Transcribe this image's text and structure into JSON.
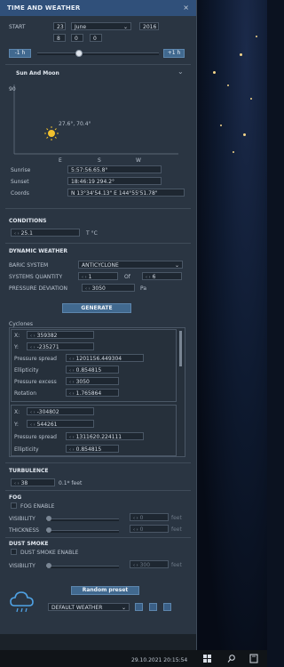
{
  "window": {
    "title": "TIME AND WEATHER",
    "close": "×"
  },
  "start": {
    "label": "START",
    "day": "23",
    "month": "June",
    "year": "2016",
    "hour": "8",
    "minute": "0",
    "second": "0",
    "minus_label": "-1 h",
    "plus_label": "+1 h",
    "slider_fraction": 0.34
  },
  "sun_moon": {
    "title": "Sun And Moon",
    "scale_top": "90",
    "sun_pos_label": "27.6°, 70.4°",
    "compass": [
      "E",
      "S",
      "W"
    ],
    "sunrise_label": "Sunrise",
    "sunrise": "5:57:56.65.8°",
    "sunset_label": "Sunset",
    "sunset": "18:46:19 294.2°",
    "coords_label": "Coords",
    "coords": "N 13°34'54.13\"  E 144°55'51.78\""
  },
  "conditions": {
    "title": "CONDITIONS",
    "temp": "25.1",
    "unit": "T °C"
  },
  "dynamic_weather": {
    "title": "DYNAMIC WEATHER",
    "baric_label": "BARIC SYSTEM",
    "baric_value": "ANTICYCLONE",
    "systems_label": "SYSTEMS QUANTITY",
    "systems_value": "1",
    "of_label": "Of",
    "systems_max": "6",
    "pressure_label": "PRESSURE DEVIATION",
    "pressure_value": "3050",
    "pressure_unit": "Pa",
    "generate_label": "GENERATE",
    "cyclones_label": "Cyclones",
    "cyclones": [
      {
        "x": "359382",
        "y": "-235271",
        "spread": "1201156.449304",
        "ellipticity": "0.854815",
        "excess": "3050",
        "rotation": "1.765864"
      },
      {
        "x": "-304802",
        "y": "544261",
        "spread": "1311620.224111",
        "ellipticity": "0.854815"
      }
    ],
    "field_labels": {
      "x": "X:",
      "y": "Y:",
      "spread": "Pressure spread",
      "ellipticity": "Ellipticity",
      "excess": "Pressure excess",
      "rotation": "Rotation"
    }
  },
  "turbulence": {
    "title": "TURBULENCE",
    "value": "38",
    "unit": "0.1* feet"
  },
  "fog": {
    "title": "FOG",
    "enable_label": "FOG ENABLE",
    "visibility_label": "VISIBILITY",
    "thickness_label": "THICKNESS",
    "visibility_value": "0",
    "thickness_value": "0",
    "unit": "feet"
  },
  "dust": {
    "title": "DUST SMOKE",
    "enable_label": "DUST SMOKE ENABLE",
    "visibility_label": "VISIBILITY",
    "visibility_value": "300",
    "unit": "feet"
  },
  "preset": {
    "random_label": "Random preset",
    "weather_value": "DEFAULT WEATHER"
  },
  "taskbar": {
    "datetime": "29.10.2021 20:15:54"
  }
}
